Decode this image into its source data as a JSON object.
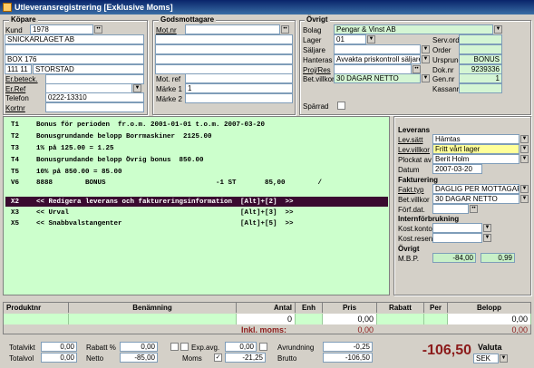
{
  "window": {
    "title": "Utleveransregistrering [Exklusive Moms]"
  },
  "kopare": {
    "title": "Köpare",
    "kund_label": "Kund",
    "kund": "1978",
    "name": "SNICKARLAGET AB",
    "line2": "",
    "addr": "BOX 176",
    "zip": "111 11",
    "city": "STORSTAD",
    "erbeteck_label": "Er.beteck.",
    "erref_label": "Er.Ref",
    "telefon_label": "Telefon",
    "telefon": "0222-13310",
    "kortnr_label": "Kortnr"
  },
  "godsmottagare": {
    "title": "Godsmottagare",
    "motnr_label": "Mot.nr",
    "motref_label": "Mot. ref",
    "marke1_label": "Märke 1",
    "marke1": "1",
    "marke2_label": "Märke 2"
  },
  "ovrigt": {
    "title": "Övrigt",
    "bolag_label": "Bolag",
    "bolag": "Pengar & Vinst AB",
    "lager_label": "Lager",
    "lager": "01",
    "saljare_label": "Säljare",
    "hanteras_label": "Hanteras",
    "hanteras": "Avvakta priskontroll säljare",
    "projres_label": "Proj/Res",
    "betvillkor_label": "Bet.villkor",
    "betvillkor": "30 DAGAR NETTO",
    "sparrad_label": "Spärrad",
    "servord_label": "Serv.ord",
    "order_label": "Order",
    "ursprung_label": "Ursprung",
    "ursprung": "BONUS",
    "doknr_label": "Dok.nr",
    "doknr": "9239336",
    "gennr_label": "Gen.nr",
    "gennr": "1",
    "kassanr_label": "Kassanr"
  },
  "text_lines": [
    {
      "code": "T1",
      "text": "Bonus för perioden  fr.o.m. 2001-01-01 t.o.m. 2007-03-20"
    },
    {
      "code": "T2",
      "text": "Bonusgrundande belopp Borrmaskiner  2125.00"
    },
    {
      "code": "T3",
      "text": "1% på 125.00 = 1.25"
    },
    {
      "code": "T4",
      "text": "Bonusgrundande belopp Övrig bonus  850.00"
    },
    {
      "code": "T5",
      "text": "10% på 850.00 = 85.00"
    },
    {
      "code": "V6",
      "text": "8888        BONUS                           -1 ST       85,00        /"
    }
  ],
  "menu_lines": [
    {
      "code": "X2",
      "text": "<< Redigera leverans och faktureringsinformation  [Alt]+[2]  >>"
    },
    {
      "code": "X3",
      "text": "<< Urval                                          [Alt]+[3]  >>"
    },
    {
      "code": "X5",
      "text": "<< Snabbvalstangenter                             [Alt]+[5]  >>"
    }
  ],
  "leverans": {
    "title": "Leverans",
    "levsatt_label": "Lev.sätt",
    "levsatt": "Hämtas",
    "levvillkor_label": "Lev.villkor",
    "levvillkor": "Fritt vårt lager",
    "plockat_label": "Plockat av",
    "plockat": "Berit Holm",
    "datum_label": "Datum",
    "datum": "2007-03-20"
  },
  "fakturering": {
    "title": "Fakturering",
    "fakttyp_label": "Fakt.typ",
    "fakttyp": "DAGLIG PER MOTTAGARE",
    "betvillkor_label": "Bet.villkor",
    "betvillkor": "30 DAGAR NETTO",
    "forfdat_label": "Förf.dat."
  },
  "internforbrukning": {
    "title": "Internförbrukning",
    "kostkonto_label": "Kost.konto",
    "kostresenh_label": "Kost.resenh"
  },
  "ovrigt2": {
    "title": "Övrigt",
    "mbp_label": "M.B.P.",
    "mbp": "-84,00",
    "mbp2": "0,99"
  },
  "grid": {
    "headers": [
      "Produktnr",
      "Benämning",
      "Antal",
      "Enh",
      "Pris",
      "Rabatt",
      "Per",
      "Belopp"
    ],
    "antal": "0",
    "pris": "0,00",
    "belopp": "0,00",
    "inkl_label": "Inkl. moms:",
    "inkl_pris": "0,00",
    "inkl_belopp": "0,00"
  },
  "totals": {
    "totalvikt_label": "Totalvikt",
    "totalvikt": "0,00",
    "totalvol_label": "Totalvol",
    "totalvol": "0,00",
    "rabatt_label": "Rabatt %",
    "rabatt": "0,00",
    "netto_label": "Netto",
    "netto": "-85,00",
    "expavg_label": "Exp.avg.",
    "expavg": "0,00",
    "moms_label": "Moms",
    "moms": "-21,25",
    "avrundning_label": "Avrundning",
    "avrundning": "-0,25",
    "brutto_label": "Brutto",
    "brutto": "-106,50",
    "total": "-106,50",
    "valuta_label": "Valuta",
    "valuta": "SEK"
  }
}
